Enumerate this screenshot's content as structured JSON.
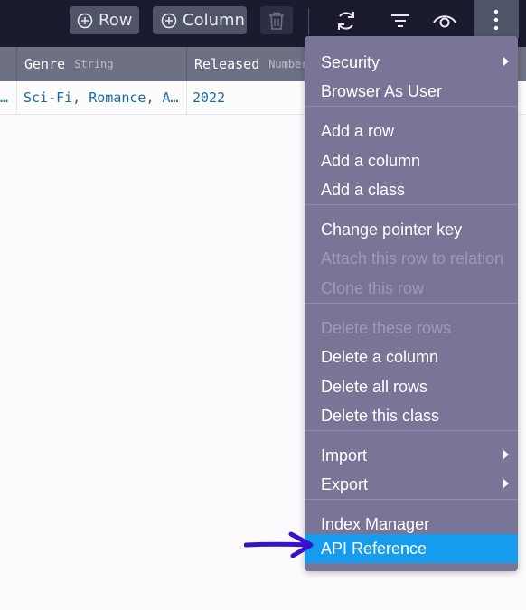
{
  "toolbar": {
    "row_label": "Row",
    "column_label": "Column",
    "icons": [
      "plus-circle-icon",
      "trash-icon",
      "refresh-icon",
      "filter-icon",
      "eye-icon",
      "more-vertical-icon"
    ]
  },
  "table": {
    "columns": [
      {
        "name": "",
        "type": ""
      },
      {
        "name": "Genre",
        "type": "String"
      },
      {
        "name": "Released",
        "type": "Number"
      }
    ],
    "row": {
      "first_cell": "…",
      "genre": "Sci-Fi, Romance, A…",
      "released": "2022"
    }
  },
  "menu": {
    "groups": [
      [
        {
          "label": "Security",
          "submenu": true,
          "disabled": false
        },
        {
          "label": "Browser As User",
          "submenu": false,
          "disabled": false
        }
      ],
      [
        {
          "label": "Add a row",
          "disabled": false
        },
        {
          "label": "Add a column",
          "disabled": false
        },
        {
          "label": "Add a class",
          "disabled": false
        }
      ],
      [
        {
          "label": "Change pointer key",
          "disabled": false
        },
        {
          "label": "Attach this row to relation",
          "disabled": true
        },
        {
          "label": "Clone this row",
          "disabled": true
        }
      ],
      [
        {
          "label": "Delete these rows",
          "disabled": true
        },
        {
          "label": "Delete a column",
          "disabled": false
        },
        {
          "label": "Delete all rows",
          "disabled": false
        },
        {
          "label": "Delete this class",
          "disabled": false
        }
      ],
      [
        {
          "label": "Import",
          "submenu": true,
          "disabled": false
        },
        {
          "label": "Export",
          "submenu": true,
          "disabled": false
        }
      ],
      [
        {
          "label": "Index Manager",
          "disabled": false
        },
        {
          "label": "API Reference",
          "disabled": false,
          "highlighted": true
        }
      ]
    ]
  },
  "colors": {
    "toolbar_bg": "#1a1b2e",
    "menu_bg": "#787596",
    "highlight": "#169cee",
    "annotation_arrow": "#3a10c8"
  }
}
